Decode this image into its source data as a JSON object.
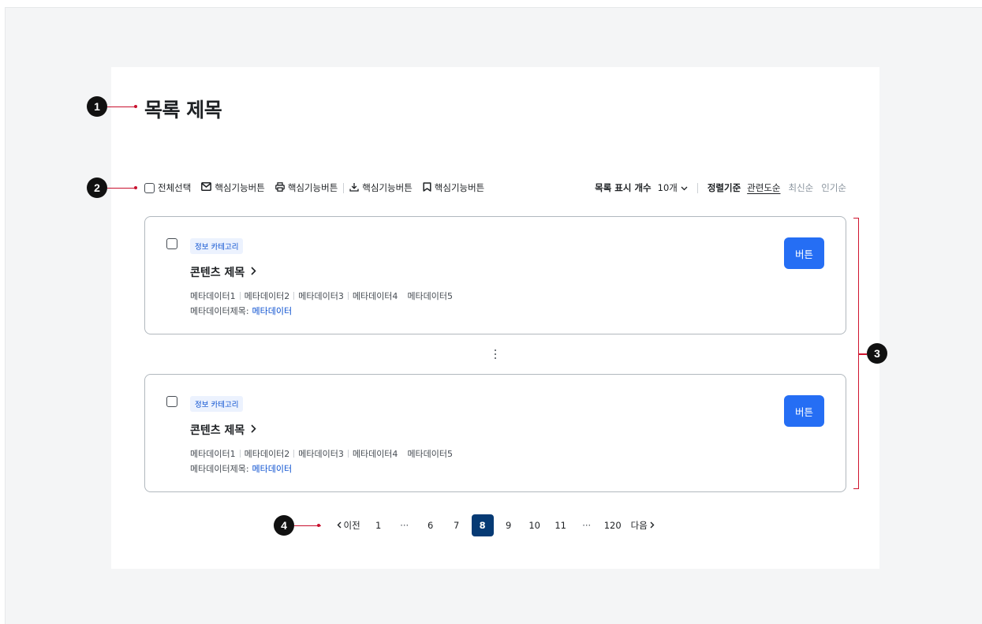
{
  "title": "목록 제목",
  "markers": [
    "1",
    "2",
    "3",
    "4"
  ],
  "toolbar": {
    "select_all": "전체선택",
    "actions": [
      {
        "label": "핵심기능버튼",
        "icon": "mail-icon"
      },
      {
        "label": "핵심기능버튼",
        "icon": "print-icon"
      },
      {
        "label": "핵심기능버튼",
        "icon": "download-icon"
      },
      {
        "label": "핵심기능버튼",
        "icon": "bookmark-icon"
      }
    ],
    "page_size_label": "목록 표시 개수",
    "page_size_value": "10개",
    "sort_label": "정렬기준",
    "sort_options": [
      "관련도순",
      "최신순",
      "인기순"
    ],
    "sort_active": "관련도순"
  },
  "cards": [
    {
      "category": "정보 카테고리",
      "title": "콘텐츠 제목",
      "metadata": [
        "메타데이터1",
        "메타데이터2",
        "메타데이터3",
        "메타데이터4",
        "메타데이터5"
      ],
      "meta_title": "메타데이터제목:",
      "meta_link": "메타데이터",
      "button": "버튼"
    },
    {
      "category": "정보 카테고리",
      "title": "콘텐츠 제목",
      "metadata": [
        "메타데이터1",
        "메타데이터2",
        "메타데이터3",
        "메타데이터4",
        "메타데이터5"
      ],
      "meta_title": "메타데이터제목:",
      "meta_link": "메타데이터",
      "button": "버튼"
    }
  ],
  "pagination": {
    "prev": "이전",
    "next": "다음",
    "pages": [
      "1",
      "···",
      "6",
      "7",
      "8",
      "9",
      "10",
      "11",
      "···",
      "120"
    ],
    "current": "8"
  },
  "colors": {
    "primary": "#256ef4",
    "pagination_active": "#063a74",
    "annotation": "#c8102e",
    "badge_bg": "#ecf2fe",
    "link": "#0b50d0"
  }
}
